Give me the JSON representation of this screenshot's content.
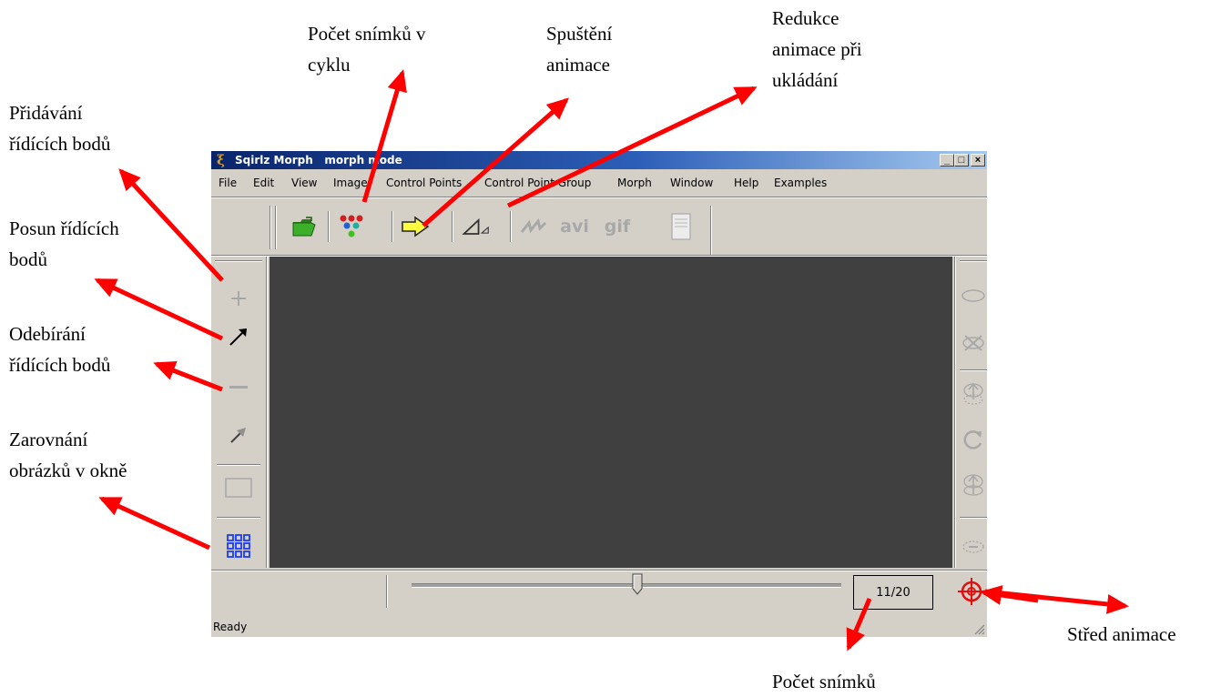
{
  "callouts": {
    "pocet_snimku_v_cyklu": "Počet snímků v\ncyklu",
    "spusteni_animace": "Spuštění\nanimace",
    "redukce_animace": "Redukce\nanimace při\nukládání",
    "pridavani_bodu": "Přidávání\nřídících bodů",
    "posun_bodu": "Posun řídících\nbodů",
    "odebirani_bodu": "Odebírání\nřídících bodů",
    "zarovnani": "Zarovnání\nobrázků v okně",
    "stred_animace": "Střed animace",
    "pocet_snimku": "Počet snímků"
  },
  "window": {
    "app_name": "Sqirlz Morph",
    "mode": "morph mode",
    "minimize": "_",
    "maximize": "□",
    "close": "×"
  },
  "menu": [
    "File",
    "Edit",
    "View",
    "Image",
    "Control Points",
    "Control Point Group",
    "Morph",
    "Window",
    "Help",
    "Examples"
  ],
  "toolbar": {
    "icons": [
      "open-folder-icon",
      "frames-cycle-icon",
      "play-arrow-icon",
      "reduce-icon",
      "morph-wave-icon",
      "avi-icon",
      "gif-icon",
      "document-icon"
    ],
    "avi": "avi",
    "gif": "gif"
  },
  "left_tools": [
    "add-point-icon",
    "move-point-icon",
    "remove-point-icon",
    "align-points-icon",
    "single-frame-icon",
    "grid-align-icon"
  ],
  "right_tools": [
    "ellipse-icon",
    "delete-group-icon",
    "move-up-icon",
    "rotate-icon",
    "move-down-icon",
    "ellipse-dashed-icon"
  ],
  "slider": {
    "frame": 11,
    "total": 20
  },
  "frame_counter": "11/20",
  "status": "Ready",
  "colors": {
    "arrow": "#ff0000",
    "titlebar_start": "#0a246a",
    "titlebar_end": "#a6caf0",
    "canvas": "#404040",
    "window": "#d4d0c8"
  }
}
